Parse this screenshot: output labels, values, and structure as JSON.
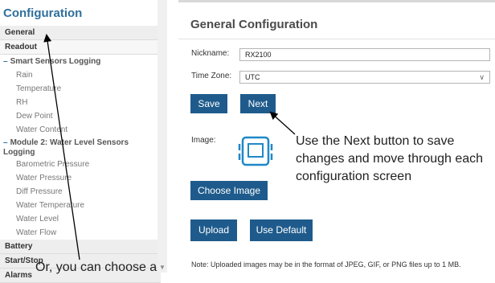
{
  "sidebar": {
    "title": "Configuration",
    "rows": [
      {
        "kind": "section",
        "label": "General"
      },
      {
        "kind": "section",
        "label": "Readout"
      },
      {
        "kind": "group",
        "label": "Smart Sensors Logging"
      },
      {
        "kind": "item",
        "label": "Rain"
      },
      {
        "kind": "item",
        "label": "Temperature"
      },
      {
        "kind": "item",
        "label": "RH"
      },
      {
        "kind": "item",
        "label": "Dew Point"
      },
      {
        "kind": "item",
        "label": "Water Content"
      },
      {
        "kind": "group",
        "label": "Module 2: Water Level Sensors Logging"
      },
      {
        "kind": "item",
        "label": "Barometric Pressure"
      },
      {
        "kind": "item",
        "label": "Water Pressure"
      },
      {
        "kind": "item",
        "label": "Diff Pressure"
      },
      {
        "kind": "item",
        "label": "Water Temperature"
      },
      {
        "kind": "item",
        "label": "Water Level"
      },
      {
        "kind": "item",
        "label": "Water Flow"
      },
      {
        "kind": "section",
        "label": "Battery"
      },
      {
        "kind": "section",
        "label": "Start/Stop"
      },
      {
        "kind": "section",
        "label": "Alarms"
      }
    ]
  },
  "main": {
    "title": "General Configuration",
    "nickname_label": "Nickname:",
    "nickname_value": "RX2100",
    "timezone_label": "Time Zone:",
    "timezone_value": "UTC",
    "save_label": "Save",
    "next_label": "Next",
    "image_label": "Image:",
    "choose_image_label": "Choose Image",
    "upload_label": "Upload",
    "use_default_label": "Use Default",
    "note": "Note: Uploaded images may be in the format of JPEG, GIF, or PNG files up to 1 MB."
  },
  "annotations": {
    "callout": "Use the Next button to save changes and move through each configuration screen",
    "bottom": "Or, you can choose a"
  },
  "colors": {
    "accent": "#2f6f9c",
    "button": "#1e5b8c"
  },
  "icons": {
    "image_placeholder": "device-image-icon",
    "scroll_down": "chevron-down-icon",
    "select_dropdown": "chevron-down-icon"
  }
}
